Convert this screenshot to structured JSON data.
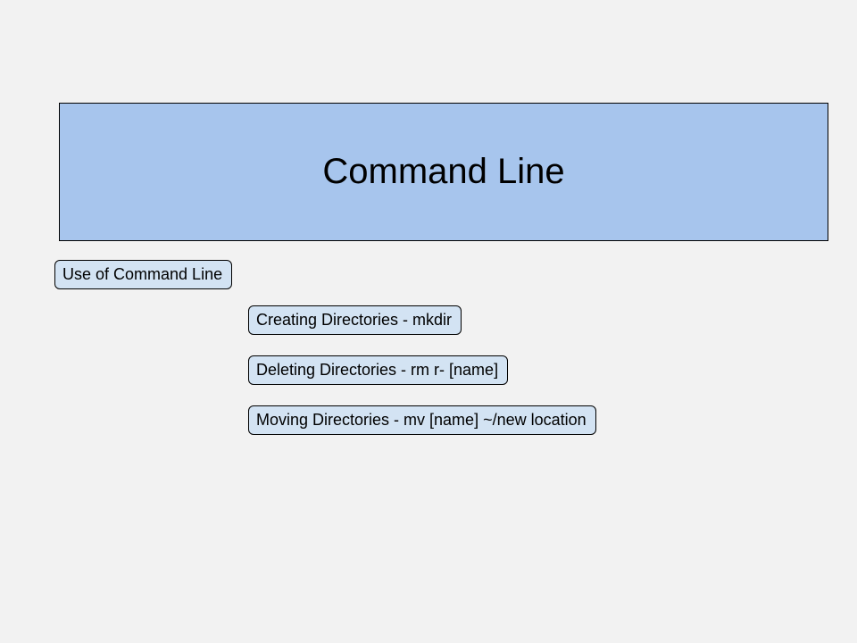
{
  "title": "Command Line",
  "nodes": {
    "use": "Use of Command Line",
    "create": "Creating Directories - mkdir",
    "delete": "Deleting Directories - rm r- [name]",
    "move": "Moving Directories - mv [name] ~/new location"
  }
}
